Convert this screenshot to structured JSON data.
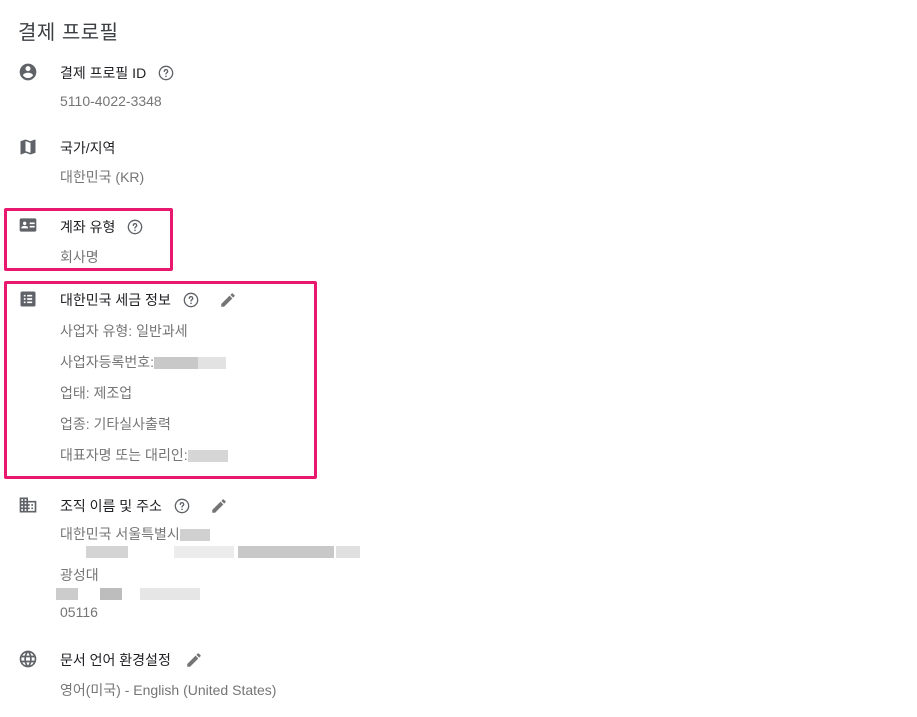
{
  "page": {
    "title": "결제 프로필"
  },
  "profile_id": {
    "label": "결제 프로필 ID",
    "value": "5110-4022-3348"
  },
  "country": {
    "label": "국가/지역",
    "value": "대한민국 (KR)"
  },
  "account_type": {
    "label": "계좌 유형",
    "value": "회사명"
  },
  "tax_info": {
    "label": "대한민국 세금 정보",
    "business_type": "사업자 유형: 일반과세",
    "registration": "사업자등록번호:",
    "business": "업태: 제조업",
    "industry": "업종: 기타실사출력",
    "representative": "대표자명 또는 대리인:"
  },
  "org": {
    "label": "조직 이름 및 주소",
    "line1": "대한민국 서울특별시",
    "line3": "광성대",
    "line5": "05116"
  },
  "language": {
    "label": "문서 언어 환경설정",
    "value": "영어(미국) - English (United States)"
  },
  "colors": {
    "highlight": "#e8186f",
    "icon": "#5f6368",
    "muted": "#757575"
  },
  "icons": [
    "account-circle-icon",
    "map-icon",
    "id-card-icon",
    "list-icon",
    "building-icon",
    "globe-icon",
    "help-icon",
    "pencil-icon"
  ]
}
